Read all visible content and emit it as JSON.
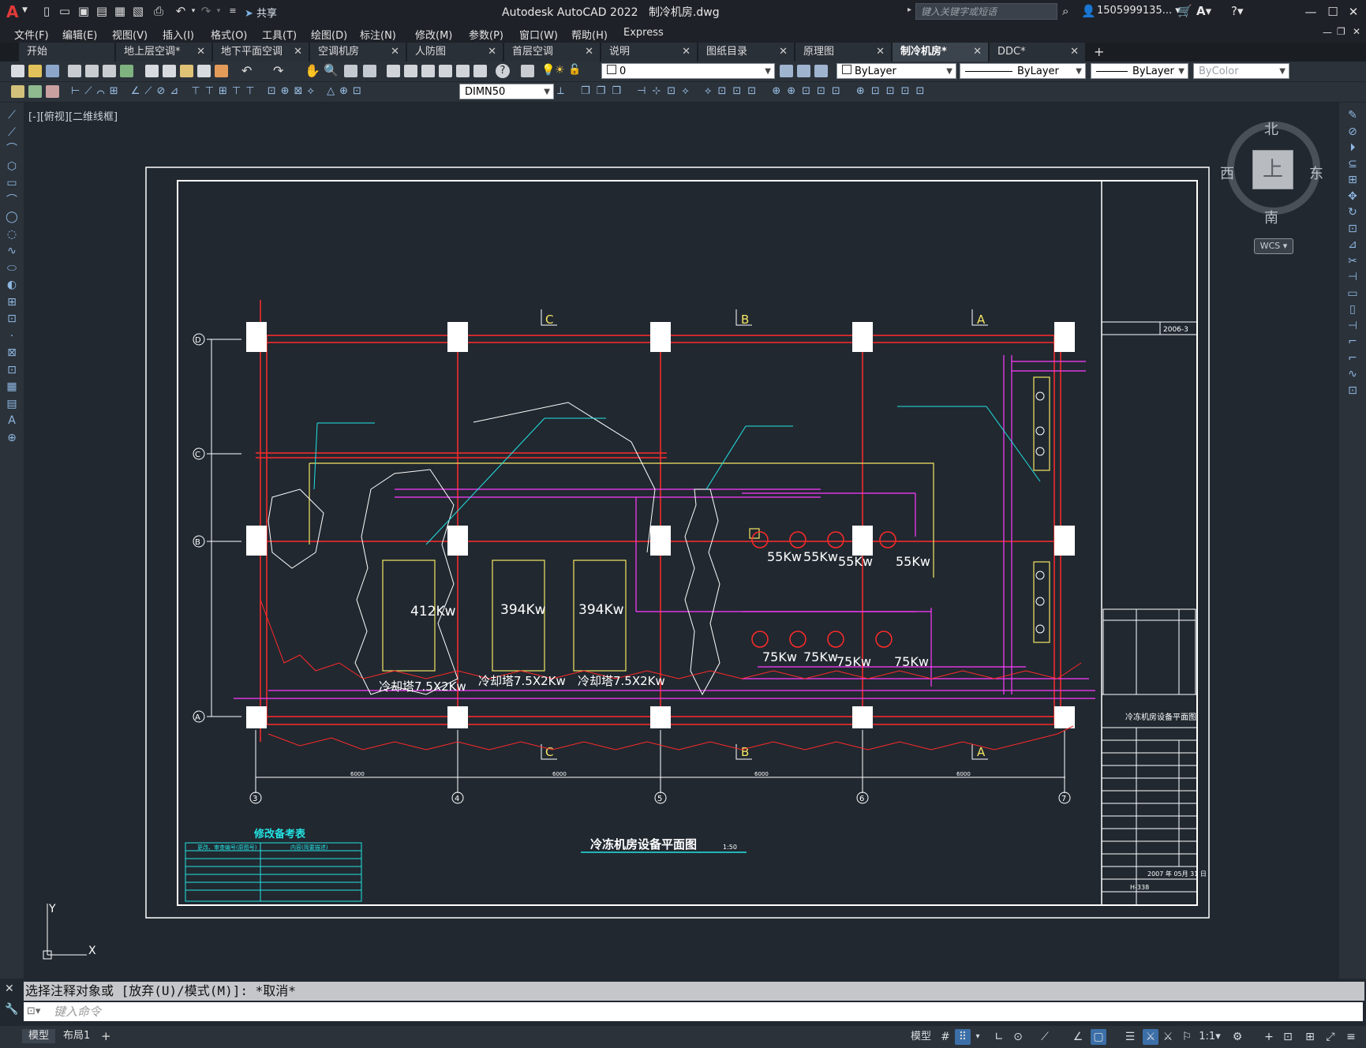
{
  "app": {
    "title": "Autodesk AutoCAD 2022",
    "filename": "制冷机房.dwg",
    "search_placeholder": "键入关键字或短语",
    "user": "1505999135...",
    "share": "共享"
  },
  "menus": [
    "文件(F)",
    "编辑(E)",
    "视图(V)",
    "插入(I)",
    "格式(O)",
    "工具(T)",
    "绘图(D)",
    "标注(N)",
    "修改(M)",
    "参数(P)",
    "窗口(W)",
    "帮助(H)",
    "Express"
  ],
  "tabs": [
    {
      "label": "开始",
      "closable": false,
      "active": false
    },
    {
      "label": "地上层空调*",
      "closable": true,
      "active": false
    },
    {
      "label": "地下平面空调",
      "closable": true,
      "active": false
    },
    {
      "label": "空调机房",
      "closable": true,
      "active": false
    },
    {
      "label": "人防图",
      "closable": true,
      "active": false
    },
    {
      "label": "首层空调",
      "closable": true,
      "active": false
    },
    {
      "label": "说明",
      "closable": true,
      "active": false
    },
    {
      "label": "图纸目录",
      "closable": true,
      "active": false
    },
    {
      "label": "原理图",
      "closable": true,
      "active": false
    },
    {
      "label": "制冷机房*",
      "closable": true,
      "active": true
    },
    {
      "label": "DDC*",
      "closable": true,
      "active": false
    }
  ],
  "toolbar": {
    "layer_value": "0",
    "color_value": "ByLayer",
    "linetype_value": "ByLayer",
    "lineweight_value": "ByLayer",
    "plotstyle_value": "ByColor",
    "dimstyle_value": "DIMN50"
  },
  "viewport": {
    "label": "[-][俯视][二维线框]",
    "compass": {
      "north": "北",
      "south": "南",
      "east": "东",
      "west": "西",
      "top": "上"
    },
    "wcs": "WCS"
  },
  "drawing": {
    "title": "冷冻机房设备平面图",
    "scale": "1:50",
    "grid_rows": [
      "D",
      "C",
      "B",
      "A"
    ],
    "grid_cols": [
      "3",
      "4",
      "5",
      "6",
      "7"
    ],
    "section_marks": [
      "C",
      "B",
      "A"
    ],
    "dims": [
      "6000",
      "6000",
      "6000",
      "6000"
    ],
    "chillers": [
      "412Kw",
      "394Kw",
      "394Kw"
    ],
    "cooling_towers": [
      "冷却塔7.5X2Kw",
      "冷却塔7.5X2Kw",
      "冷却塔7.5X2Kw"
    ],
    "pumps_top": [
      "55Kw",
      "55Kw",
      "55Kw",
      "55Kw"
    ],
    "pumps_bottom": [
      "75Kw",
      "75Kw",
      "75Kw",
      "75Kw"
    ],
    "revision_table_title": "修改备考表",
    "revision_header": [
      "更改、审查编号(原图号)",
      "内容(简要描述)"
    ],
    "project_number": "2006-3",
    "titleblock_title": "冷冻机房设备平面图",
    "date_value": "2007 年 05月 31 日",
    "sheet_number": "H-338"
  },
  "command": {
    "history": "选择注释对象或 [放弃(U)/模式(M)]: *取消*",
    "input_placeholder": "键入命令"
  },
  "status": {
    "layout_tabs": [
      "模型",
      "布局1"
    ],
    "model_label": "模型",
    "scale": "1:1"
  }
}
